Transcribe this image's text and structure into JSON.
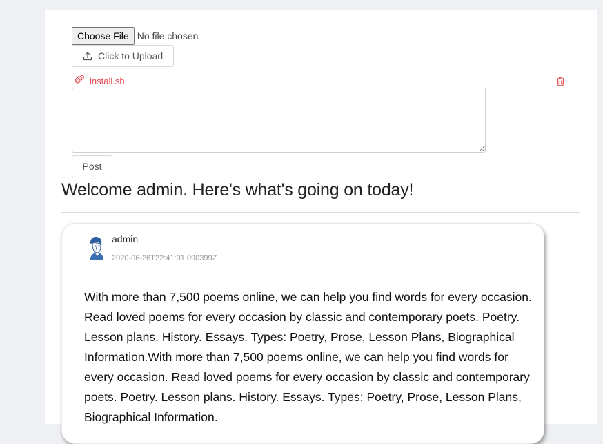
{
  "composer": {
    "choose_file_label": "Choose File",
    "no_file_text": "No file chosen",
    "upload_label": "Click to Upload",
    "attachment_name": "install.sh",
    "textarea_value": "",
    "post_label": "Post"
  },
  "welcome": {
    "text": "Welcome admin. Here's what's going on today!"
  },
  "feed": {
    "posts": [
      {
        "author": "admin",
        "timestamp": "2020-06-26T22:41:01.090399Z",
        "body": "With more than 7,500 poems online, we can help you find words for every occasion. Read loved poems for every occasion by classic and contemporary poets. Poetry. Lesson plans. History. Essays. Types: Poetry, Prose, Lesson Plans, Biographical Information.With more than 7,500 poems online, we can help you find words for every occasion. Read loved poems for every occasion by classic and contemporary poets. Poetry. Lesson plans. History. Essays. Types: Poetry, Prose, Lesson Plans, Biographical Information."
      }
    ]
  },
  "icons": {
    "upload": "upload-icon",
    "attachment": "paperclip-icon",
    "delete": "trash-icon",
    "avatar": "user-avatar"
  },
  "colors": {
    "attachment_text": "#e5484d",
    "delete_icon": "#e5484d",
    "page_background": "#eef0f3"
  }
}
